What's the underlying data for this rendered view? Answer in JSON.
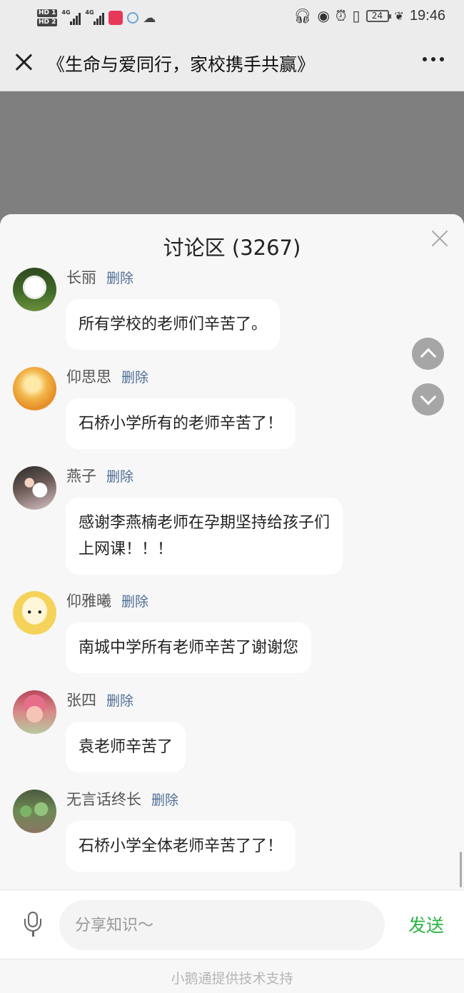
{
  "status_bar": {
    "hd1": "HD 1",
    "hd2": "HD 2",
    "net1": "4G",
    "net2": "4G",
    "battery": "24",
    "time": "19:46"
  },
  "header": {
    "title": "《生命与爱同行，家校携手共赢》"
  },
  "discussion": {
    "title": "讨论区 (3267)",
    "delete_label": "删除",
    "messages": [
      {
        "name": "长丽",
        "text": "所有学校的老师们辛苦了。",
        "avatar": "poodle-photo"
      },
      {
        "name": "仰思思",
        "text": "石桥小学所有的老师辛苦了！",
        "avatar": "food-photo"
      },
      {
        "name": "燕子",
        "text": "感谢李燕楠老师在孕期坚持给孩子们\n上网课！！！",
        "avatar": "family-photo"
      },
      {
        "name": "仰雅曦",
        "text": "南城中学所有老师辛苦了谢谢您",
        "avatar": "cartoon-face"
      },
      {
        "name": "张四",
        "text": "袁老师辛苦了",
        "avatar": "baby-photo"
      },
      {
        "name": "无言话终长",
        "text": "石桥小学全体老师辛苦了了！",
        "avatar": "plant-photo"
      }
    ]
  },
  "composer": {
    "placeholder": "分享知识〜",
    "send_label": "发送"
  },
  "footer": {
    "text": "小鹅通提供技术支持"
  },
  "colors": {
    "accent_green": "#2cb342",
    "delete_link": "#4f6d95",
    "overlay_gray": "#7f7f7f"
  }
}
